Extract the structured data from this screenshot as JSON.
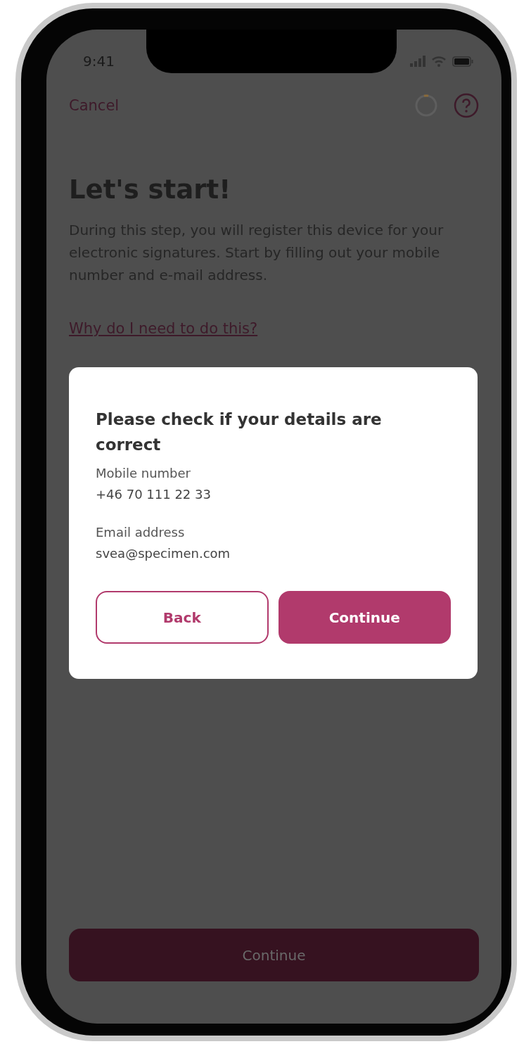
{
  "status_bar": {
    "time": "9:41"
  },
  "nav": {
    "cancel": "Cancel"
  },
  "title": "Let's start!",
  "intro": "During this step, you will register this device for your electronic signatures. Start by filling out your mobile number and e-mail address.",
  "help_link": "Why do I need to do this?",
  "dialog": {
    "title": "Please check if your details are correct",
    "fields": [
      {
        "label": "Mobile number",
        "value": "+46 70 111 22 33"
      },
      {
        "label": "Email address",
        "value": "svea@specimen.com"
      }
    ],
    "buttons": [
      {
        "label": "Back",
        "kind": "secondary"
      },
      {
        "label": "Continue",
        "kind": "primary"
      }
    ]
  },
  "footer_button": {
    "label": "Continue",
    "disabled": true
  }
}
